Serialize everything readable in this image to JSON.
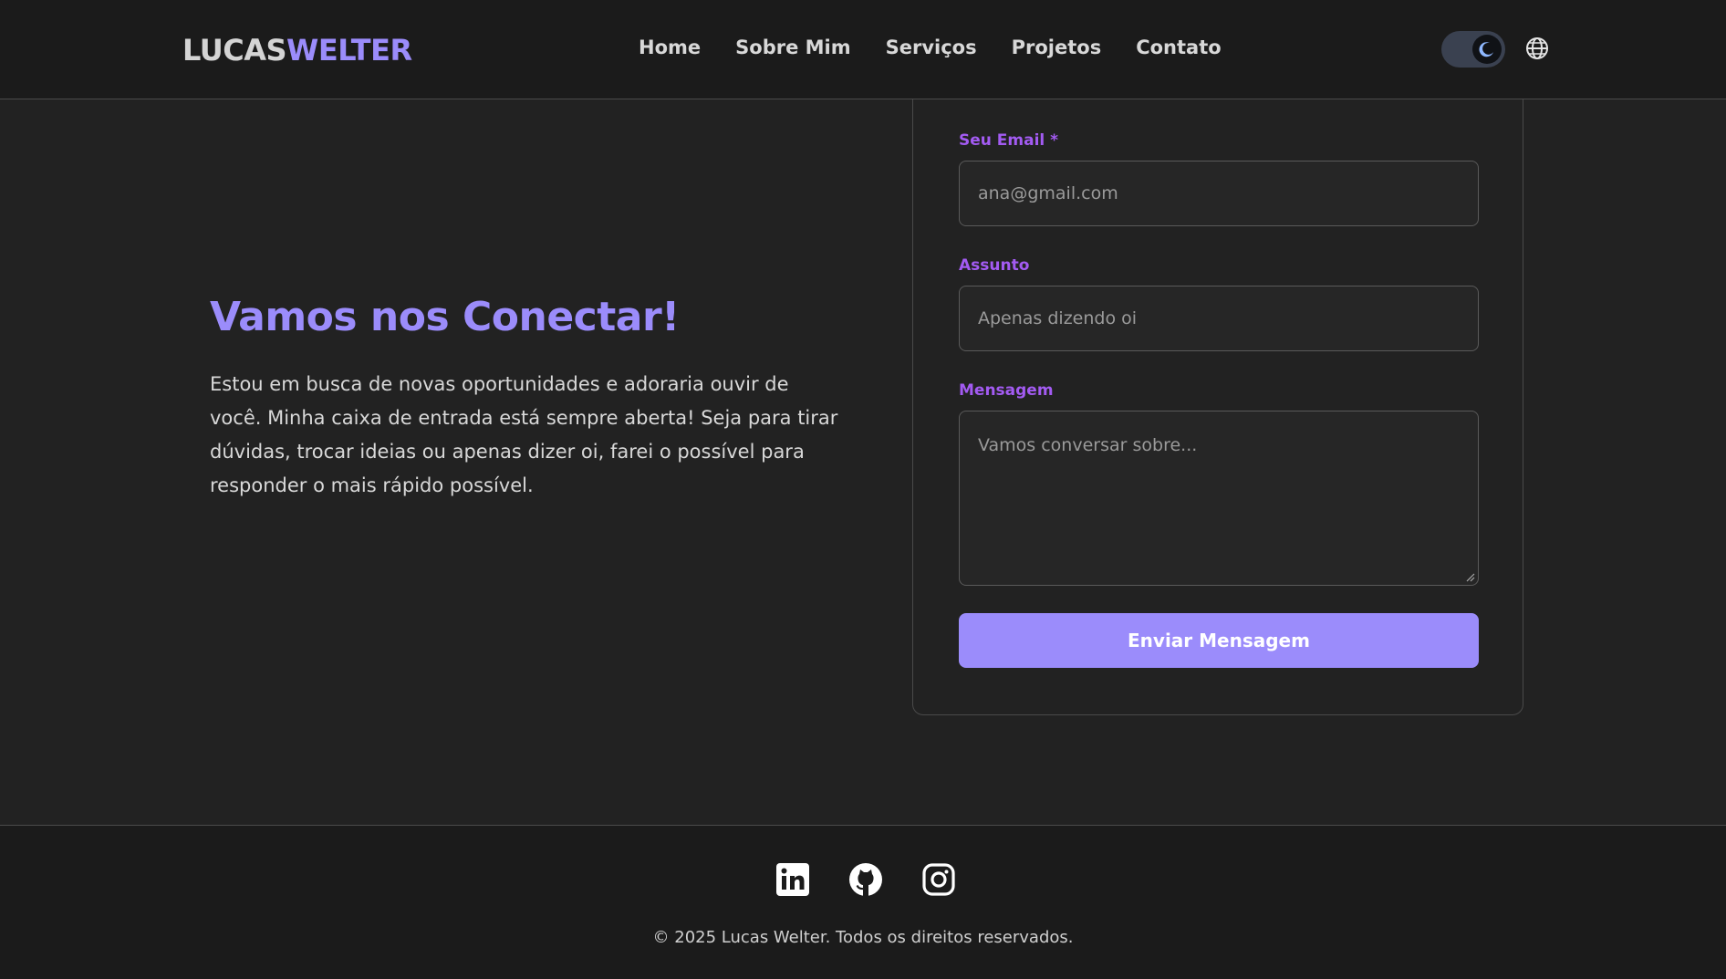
{
  "header": {
    "logo_first": "LUCAS",
    "logo_last": "WELTER",
    "nav": [
      "Home",
      "Sobre Mim",
      "Serviços",
      "Projetos",
      "Contato"
    ],
    "theme_toggle_icon": "moon-icon",
    "language_icon": "globe-icon"
  },
  "contact": {
    "title": "Vamos nos Conectar!",
    "description": "Estou em busca de novas oportunidades e adoraria ouvir de você. Minha caixa de entrada está sempre aberta! Seja para tirar dúvidas, trocar ideias ou apenas dizer oi, farei o possível para responder o mais rápido possível."
  },
  "form": {
    "email_label": "Seu Email",
    "email_required": "*",
    "email_placeholder": "ana@gmail.com",
    "subject_label": "Assunto",
    "subject_placeholder": "Apenas dizendo oi",
    "message_label": "Mensagem",
    "message_placeholder": "Vamos conversar sobre...",
    "submit_label": "Enviar Mensagem"
  },
  "footer": {
    "social": [
      "linkedin-icon",
      "github-icon",
      "instagram-icon"
    ],
    "copyright": "© 2025 Lucas Welter. Todos os direitos reservados."
  },
  "colors": {
    "accent": "#9b8cfb",
    "label": "#a35bf2",
    "background": "#222222",
    "header_background": "#1b1b1b"
  }
}
